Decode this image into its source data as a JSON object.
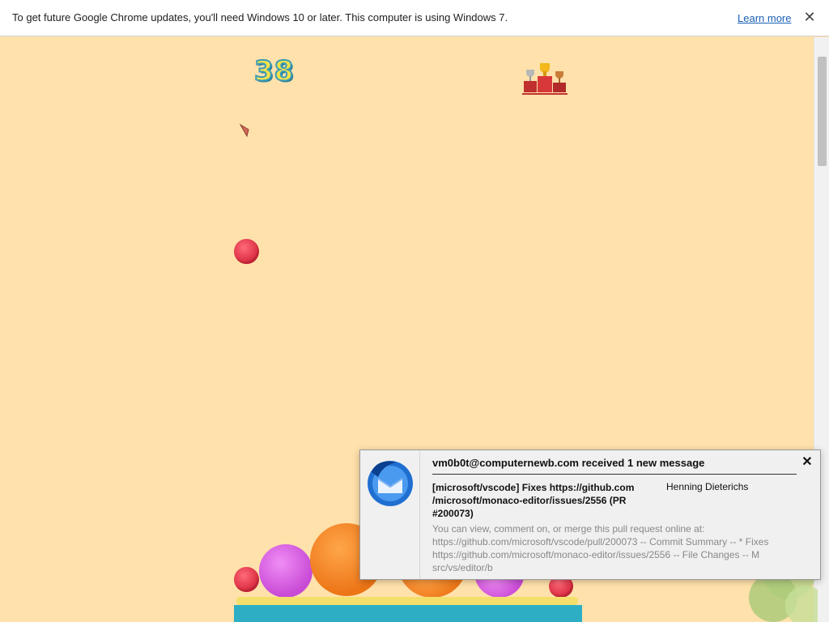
{
  "infobar": {
    "message": "To get future Google Chrome updates, you'll need Windows 10 or later. This computer is using Windows 7.",
    "learn_more": "Learn more",
    "close_glyph": "✕"
  },
  "game": {
    "score": "38",
    "trophy_icon": "podium-trophy-icon",
    "fruits": [
      "strawberry",
      "strawberry",
      "grape",
      "orange",
      "orange",
      "grape",
      "strawberry"
    ]
  },
  "notification": {
    "title": "vm0b0t@computernewb.com received 1 new message",
    "subject": "[microsoft/vscode] Fixes https://github.com /microsoft/monaco-editor/issues/2556 (PR #200073)",
    "sender": "Henning Dieterichs",
    "body": "You can view, comment on, or merge this pull request online at: https://github.com/microsoft/vscode/pull/200073 -- Commit Summary -- * Fixes https://github.com/microsoft/monaco-editor/issues/2556 -- File Changes -- M src/vs/editor/b",
    "close_glyph": "✕",
    "app_icon": "thunderbird-icon"
  },
  "colors": {
    "background": "#ffe1ab",
    "accent_link": "#1a5fb4",
    "base": "#2eaec4"
  }
}
